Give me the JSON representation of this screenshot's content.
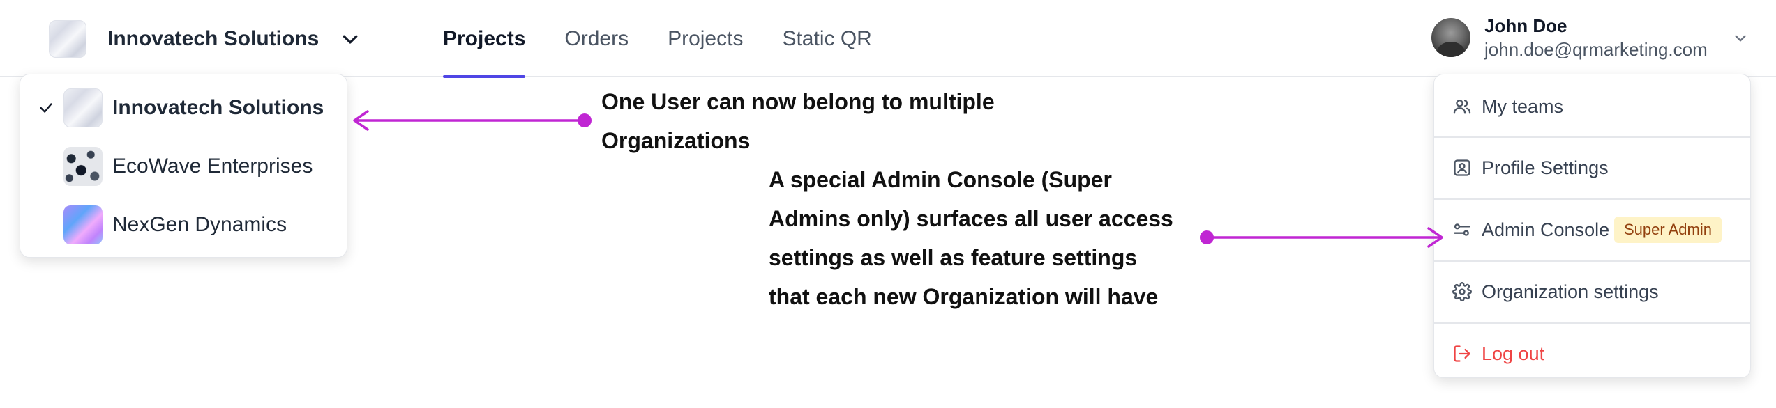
{
  "header": {
    "org_name": "Innovatech Solutions",
    "nav": [
      "Projects",
      "Orders",
      "Projects",
      "Static QR"
    ],
    "active_index": 0,
    "user": {
      "name": "John Doe",
      "email": "john.doe@qrmarketing.com"
    }
  },
  "org_menu": {
    "items": [
      {
        "label": "Innovatech Solutions",
        "selected": true
      },
      {
        "label": "EcoWave Enterprises",
        "selected": false
      },
      {
        "label": "NexGen Dynamics",
        "selected": false
      }
    ]
  },
  "user_menu": {
    "items": [
      {
        "label": "My teams",
        "icon": "users-icon"
      },
      {
        "label": "Profile Settings",
        "icon": "profile-icon"
      },
      {
        "label": "Admin Console",
        "icon": "sliders-icon",
        "badge": "Super Admin"
      },
      {
        "label": "Organization settings",
        "icon": "gear-icon"
      },
      {
        "label": "Log out",
        "icon": "logout-icon"
      }
    ]
  },
  "annotations": {
    "org_note_line1": "One User can now belong to multiple",
    "org_note_line2": "Organizations",
    "admin_note_line1": "A special Admin Console (Super",
    "admin_note_line2": "Admins only) surfaces all user access",
    "admin_note_line3": "settings as well as feature settings",
    "admin_note_line4": "that each new Organization will have"
  },
  "colors": {
    "accent": "#4f46e5",
    "annotation_arrow": "#c026d3",
    "danger": "#ef4444",
    "badge_bg": "#fef3c7",
    "badge_text": "#92400e"
  }
}
